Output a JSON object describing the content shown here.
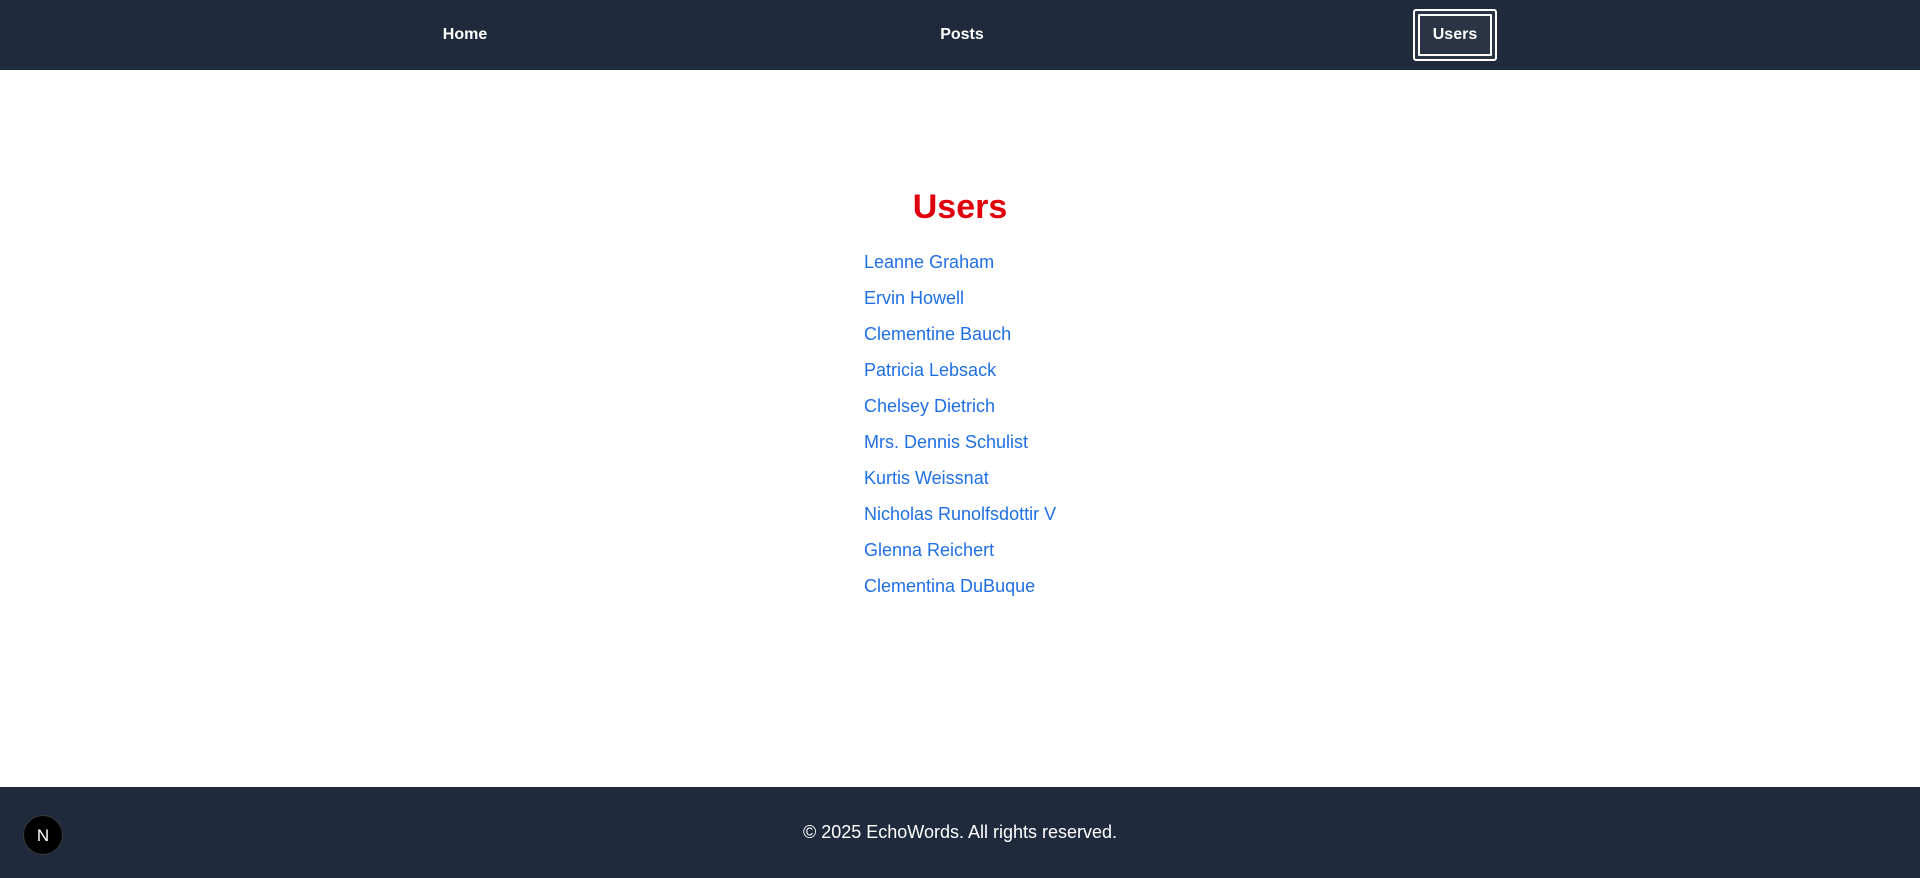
{
  "nav": {
    "items": [
      {
        "label": "Home"
      },
      {
        "label": "Posts"
      },
      {
        "label": "Users"
      }
    ],
    "active": "Users"
  },
  "page": {
    "title": "Users"
  },
  "users": [
    {
      "name": "Leanne Graham"
    },
    {
      "name": "Ervin Howell"
    },
    {
      "name": "Clementine Bauch"
    },
    {
      "name": "Patricia Lebsack"
    },
    {
      "name": "Chelsey Dietrich"
    },
    {
      "name": "Mrs. Dennis Schulist"
    },
    {
      "name": "Kurtis Weissnat"
    },
    {
      "name": "Nicholas Runolfsdottir V"
    },
    {
      "name": "Glenna Reichert"
    },
    {
      "name": "Clementina DuBuque"
    }
  ],
  "footer": {
    "text": "© 2025 EchoWords. All rights reserved."
  },
  "dev_badge": {
    "icon": "nextjs-logo-icon",
    "glyph": "N"
  },
  "colors": {
    "nav_bg": "#1f2a3c",
    "title": "#e0000b",
    "link": "#1f6fe5"
  }
}
